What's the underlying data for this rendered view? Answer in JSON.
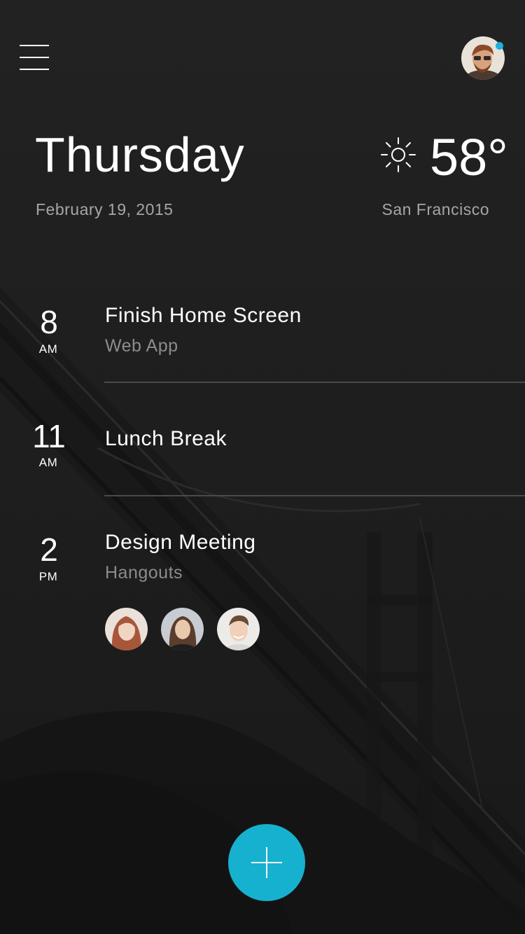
{
  "header": {
    "menu_icon": "hamburger-menu-icon",
    "profile_avatar": "user-avatar",
    "notification_color": "#1eaee0"
  },
  "today": {
    "day": "Thursday",
    "date": "February 19, 2015"
  },
  "weather": {
    "icon": "sun-icon",
    "temperature": "58°",
    "city": "San Francisco"
  },
  "events": [
    {
      "hour": "8",
      "ampm": "AM",
      "title": "Finish Home Screen",
      "subtitle": "Web App"
    },
    {
      "hour": "11",
      "ampm": "AM",
      "title": "Lunch Break",
      "subtitle": ""
    },
    {
      "hour": "2",
      "ampm": "PM",
      "title": "Design Meeting",
      "subtitle": "Hangouts"
    }
  ],
  "attendees": [
    {
      "name": "attendee-1",
      "hair": "#a8563a",
      "skin": "#f1d5c3",
      "bg": "#e9e1da"
    },
    {
      "name": "attendee-2",
      "hair": "#5a3d2c",
      "skin": "#e9c8ae",
      "bg": "#c8ccd2"
    },
    {
      "name": "attendee-3",
      "hair": "#6b4a35",
      "skin": "#f0d0b8",
      "bg": "#ecebe8"
    }
  ],
  "fab": {
    "icon": "plus-icon",
    "color": "#16b1cf"
  }
}
